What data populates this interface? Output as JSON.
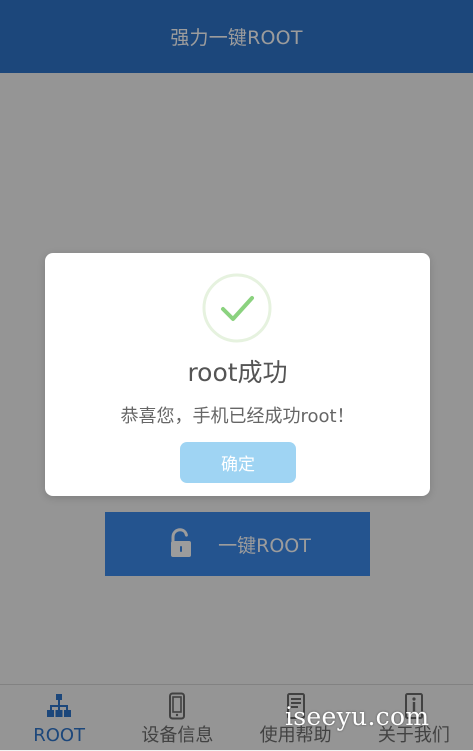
{
  "header": {
    "title": "强力一键ROOT"
  },
  "main": {
    "one_key_root_label": "一键ROOT"
  },
  "dialog": {
    "title": "root成功",
    "message": "恭喜您，手机已经成功root！",
    "confirm_label": "确定"
  },
  "tabs": [
    {
      "label": "ROOT",
      "icon": "network-icon",
      "active": true
    },
    {
      "label": "设备信息",
      "icon": "phone-icon",
      "active": false
    },
    {
      "label": "使用帮助",
      "icon": "book-icon",
      "active": false
    },
    {
      "label": "关于我们",
      "icon": "info-icon",
      "active": false
    }
  ],
  "watermark": {
    "text": "iseeyu.com"
  },
  "colors": {
    "header": "#2f74c9",
    "button": "#3b89ea",
    "active_tab": "#2f74c9",
    "confirm": "#9fd4f3",
    "success": "#8bd27f"
  }
}
